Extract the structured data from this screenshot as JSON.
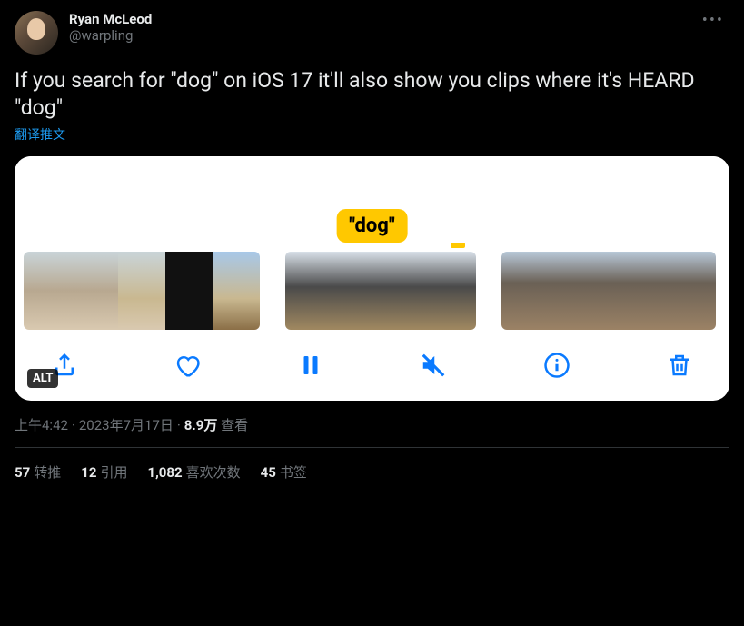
{
  "user": {
    "display_name": "Ryan McLeod",
    "handle": "@warpling"
  },
  "tweet": {
    "text": "If you search for \"dog\" on iOS 17 it'll also show you clips where it's HEARD \"dog\"",
    "translate_label": "翻译推文"
  },
  "media": {
    "caption_label": "\"dog\"",
    "alt_badge": "ALT"
  },
  "meta": {
    "time": "上午4:42",
    "date": "2023年7月17日",
    "views_count": "8.9万",
    "views_label": "查看"
  },
  "stats": {
    "retweets": {
      "count": "57",
      "label": "转推"
    },
    "quotes": {
      "count": "12",
      "label": "引用"
    },
    "likes": {
      "count": "1,082",
      "label": "喜欢次数"
    },
    "bookmarks": {
      "count": "45",
      "label": "书签"
    }
  }
}
